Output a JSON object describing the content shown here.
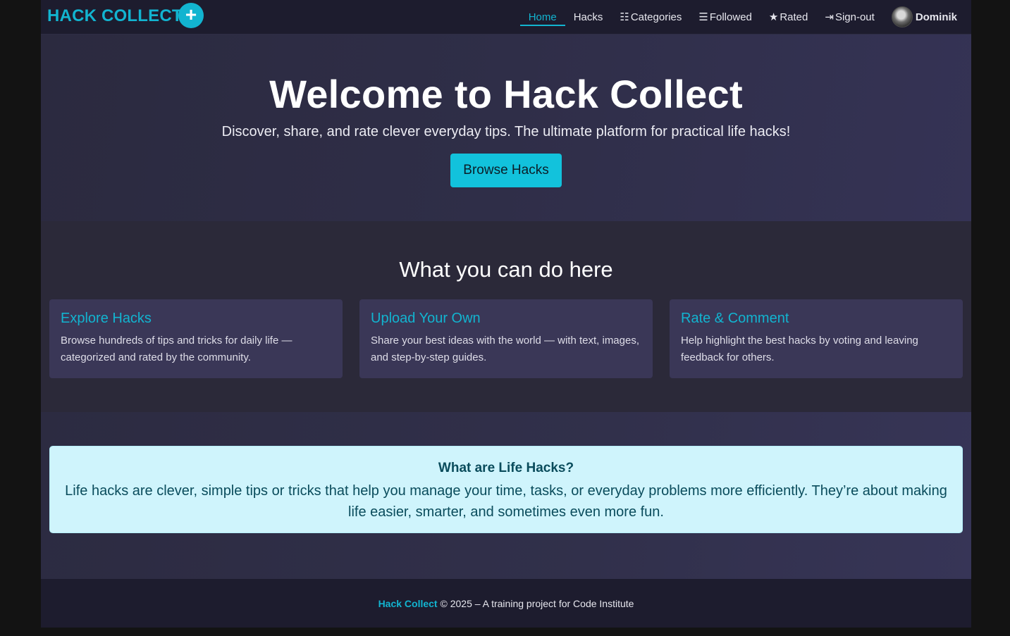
{
  "nav": {
    "brand": "HACK COLLECT",
    "add_icon": "+",
    "items": [
      {
        "label": "Home",
        "icon": ""
      },
      {
        "label": "Hacks",
        "icon": ""
      },
      {
        "label": "Categories",
        "icon": "☷"
      },
      {
        "label": "Followed",
        "icon": "☰"
      },
      {
        "label": "Rated",
        "icon": "★"
      },
      {
        "label": "Sign-out",
        "icon": "⇥"
      }
    ],
    "user": {
      "name": "Dominik"
    }
  },
  "hero": {
    "title": "Welcome to Hack Collect",
    "subtitle": "Discover, share, and rate clever everyday tips. The ultimate platform for practical life hacks!",
    "button_label": "Browse Hacks"
  },
  "features": {
    "heading": "What you can do here",
    "cards": [
      {
        "title": "Explore Hacks",
        "text": "Browse hundreds of tips and tricks for daily life — categorized and rated by the community."
      },
      {
        "title": "Upload Your Own",
        "text": "Share your best ideas with the world — with text, images, and step-by-step guides."
      },
      {
        "title": "Rate & Comment",
        "text": "Help highlight the best hacks by voting and leaving feedback for others."
      }
    ]
  },
  "info": {
    "title": "What are Life Hacks?",
    "text": "Life hacks are clever, simple tips or tricks that help you manage your time, tasks, or everyday problems more efficiently. They’re about making life easier, smarter, and sometimes even more fun."
  },
  "footer": {
    "brand": "Hack Collect",
    "text": "© 2025 – A training project for Code Institute"
  },
  "colors": {
    "accent": "#12b4d0",
    "nav_bg": "#1d1c2e",
    "card_bg": "#3a3757",
    "alert_bg": "#cff4fc"
  }
}
